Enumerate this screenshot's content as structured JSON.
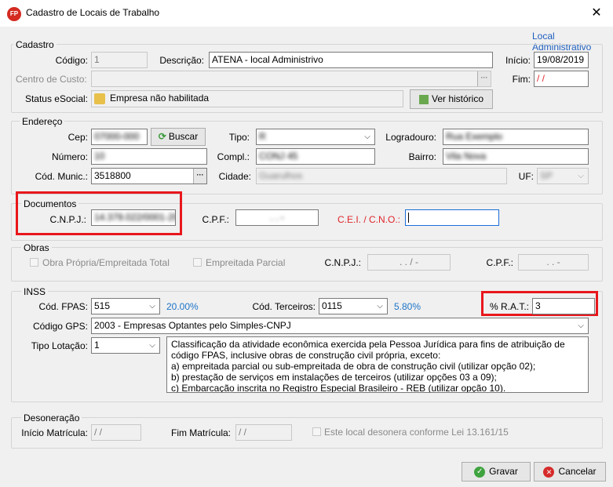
{
  "window": {
    "title": "Cadastro de Locais de Trabalho",
    "icon_text": "FP",
    "close_glyph": "✕"
  },
  "top_link": "Local Administrativo",
  "cadastro": {
    "legend": "Cadastro",
    "codigo_label": "Código:",
    "codigo_value": "1",
    "descricao_label": "Descrição:",
    "descricao_value": "ATENA - local Administrivo",
    "inicio_label": "Início:",
    "inicio_value": "19/08/2019",
    "centro_label": "Centro de Custo:",
    "fim_label": "Fim:",
    "fim_value": "/ /",
    "status_label": "Status eSocial:",
    "status_value": "Empresa não habilitada",
    "historico_button": "Ver histórico"
  },
  "endereco": {
    "legend": "Endereço",
    "cep_label": "Cep:",
    "cep_value": "07000-000",
    "buscar_button": "Buscar",
    "tipo_label": "Tipo:",
    "tipo_value": "R",
    "logradouro_label": "Logradouro:",
    "logradouro_value": "Rua Exemplo",
    "numero_label": "Número:",
    "numero_value": "10",
    "compl_label": "Compl.:",
    "compl_value": "CONJ 45",
    "bairro_label": "Bairro:",
    "bairro_value": "Vila Nova",
    "municipio_label": "Cód. Munic.:",
    "municipio_value": "3518800",
    "cidade_label": "Cidade:",
    "cidade_value": "Guarulhos",
    "uf_label": "UF:",
    "uf_value": "SP"
  },
  "documentos": {
    "legend": "Documentos",
    "cnpj_label": "C.N.P.J.:",
    "cnpj_value": "14.379.022/0001-20",
    "cpf_label": "C.P.F.:",
    "cpf_value": ". . -",
    "cei_label": "C.E.I. / C.N.O.:",
    "cei_value": ""
  },
  "obras": {
    "legend": "Obras",
    "propria_label": "Obra Própria/Empreitada Total",
    "parcial_label": "Empreitada Parcial",
    "cnpj_label": "C.N.P.J.:",
    "cnpj_value": ". . / -",
    "cpf_label": "C.P.F.:",
    "cpf_value": ". . -"
  },
  "inss": {
    "legend": "INSS",
    "fpas_label": "Cód. FPAS:",
    "fpas_value": "515",
    "fpas_pct": "20.00%",
    "terceiros_label": "Cód. Terceiros:",
    "terceiros_value": "0115",
    "terceiros_pct": "5.80%",
    "rat_label": "% R.A.T.:",
    "rat_value": "3",
    "gps_label": "Código GPS:",
    "gps_value": "2003  - Empresas Optantes pelo Simples-CNPJ",
    "lotacao_label": "Tipo Lotação:",
    "lotacao_value": "1",
    "lotacao_desc": [
      "Classificação da atividade econômica exercida pela Pessoa Jurídica para fins de atribuição de",
      "código FPAS, inclusive obras de construção civil própria, exceto:",
      "a) empreitada parcial ou sub-empreitada de obra de construção civil (utilizar opção 02);",
      "b) prestação de serviços em instalações de terceiros (utilizar opções 03 a 09);",
      "c) Embarcação inscrita no Registro Especial Brasileiro - REB (utilizar opção 10)."
    ]
  },
  "desoneracao": {
    "legend": "Desoneração",
    "inicio_label": "Início Matrícula:",
    "inicio_value": "/ /",
    "fim_label": "Fim Matrícula:",
    "fim_value": "/ /",
    "check_label": "Este local desonera conforme Lei 13.161/15"
  },
  "footer": {
    "gravar_button": "Gravar",
    "cancelar_button": "Cancelar"
  },
  "colors": {
    "highlight": "#e8171c",
    "link": "#1f5fbf",
    "accent_blue": "#1e73c8"
  }
}
